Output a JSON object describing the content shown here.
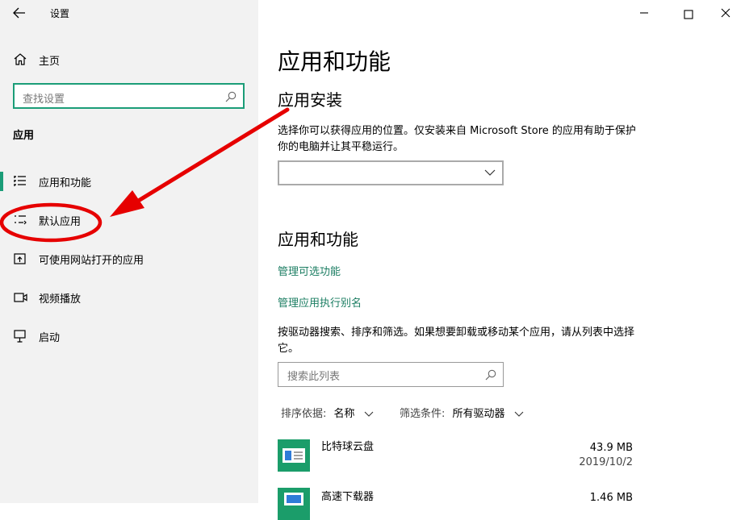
{
  "window": {
    "title": "设置"
  },
  "sidebar": {
    "home_label": "主页",
    "search_placeholder": "查找设置",
    "section_title": "应用",
    "items": [
      {
        "label": "应用和功能",
        "icon": "list-icon",
        "selected": true
      },
      {
        "label": "默认应用",
        "icon": "default-apps-icon",
        "selected": false
      },
      {
        "label": "可使用网站打开的应用",
        "icon": "open-website-icon",
        "selected": false
      },
      {
        "label": "视频播放",
        "icon": "video-icon",
        "selected": false
      },
      {
        "label": "启动",
        "icon": "startup-icon",
        "selected": false
      }
    ]
  },
  "main": {
    "page_title": "应用和功能",
    "install": {
      "heading": "应用安装",
      "description": "选择你可以获得应用的位置。仅安装来自 Microsoft Store 的应用有助于保护你的电脑并让其平稳运行。",
      "dropdown_value": ""
    },
    "features": {
      "heading": "应用和功能",
      "link_optional": "管理可选功能",
      "link_alias": "管理应用执行别名",
      "description": "按驱动器搜索、排序和筛选。如果想要卸载或移动某个应用，请从列表中选择它。",
      "search_placeholder": "搜索此列表",
      "sort_label": "排序依据:",
      "sort_value": "名称",
      "filter_label": "筛选条件:",
      "filter_value": "所有驱动器"
    },
    "apps": [
      {
        "name": "比特球云盘",
        "size": "43.9 MB",
        "date": "2019/10/2"
      },
      {
        "name": "高速下载器",
        "size": "1.46 MB",
        "date": ""
      }
    ]
  },
  "colors": {
    "accent": "#1b9d78",
    "link": "#1b7d62",
    "annotation": "#e60000",
    "sidebar_bg": "#f2f2f2"
  }
}
